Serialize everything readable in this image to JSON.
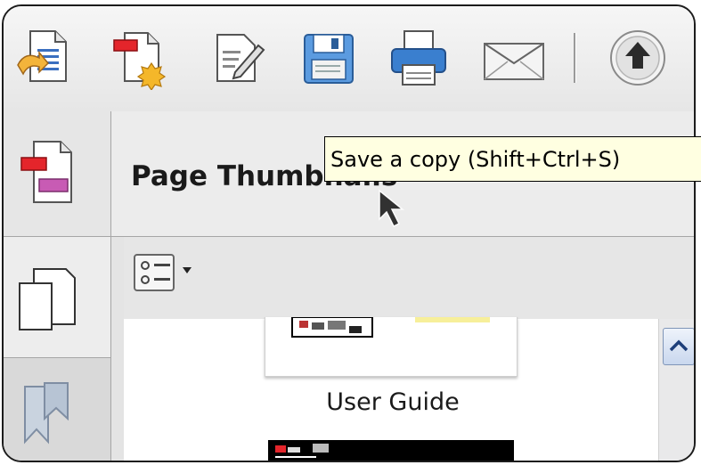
{
  "toolbar": {
    "buttons": [
      {
        "name": "open-icon",
        "label": ""
      },
      {
        "name": "create-pdf-icon",
        "label": ""
      },
      {
        "name": "edit-icon",
        "label": ""
      },
      {
        "name": "save-icon",
        "label": ""
      },
      {
        "name": "print-icon",
        "label": ""
      },
      {
        "name": "email-icon",
        "label": ""
      },
      {
        "name": "previous-page-icon",
        "label": ""
      }
    ]
  },
  "nav": {
    "items": [
      "pages-panel-icon",
      "thumbnails-icon",
      "bookmarks-icon"
    ]
  },
  "panel": {
    "title": "Page Thumbnails",
    "options_icon": "thumbnail-options-icon"
  },
  "thumbnails": [
    {
      "label": "User Guide"
    }
  ],
  "tooltip": {
    "text": "Save a copy (Shift+Ctrl+S)"
  },
  "colors": {
    "tooltip_bg": "#ffffe1",
    "toolbar_bg": "#efefef",
    "accent_red": "#e4252b",
    "accent_magenta": "#c85bb4",
    "save_blue": "#4a8fd0"
  }
}
